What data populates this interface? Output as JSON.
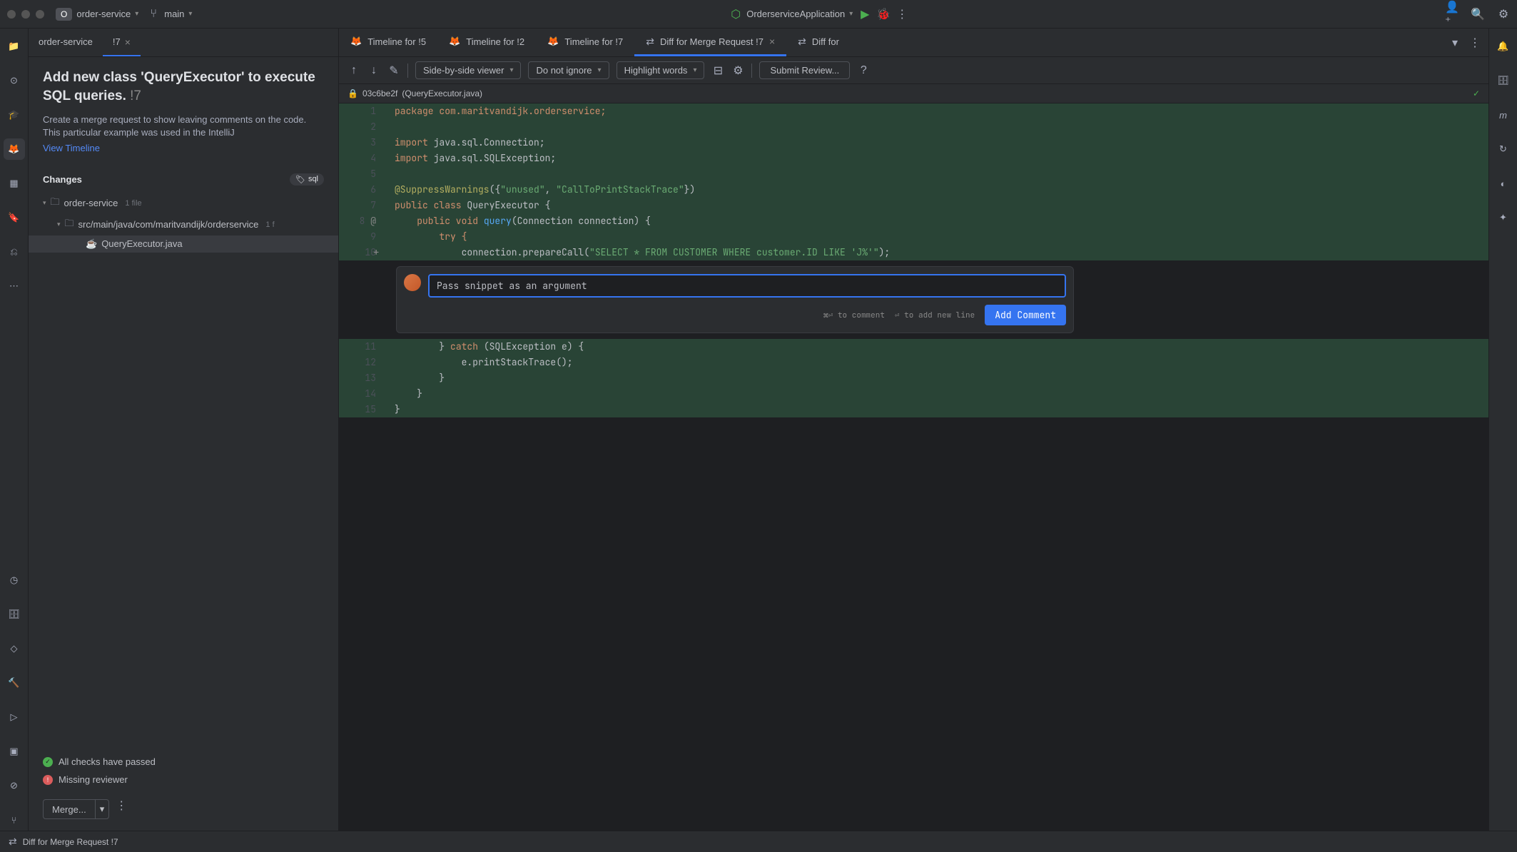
{
  "titleBar": {
    "badge": "O",
    "project": "order-service",
    "branchIcon": "⎇",
    "branch": "main",
    "runConfig": "OrderserviceApplication"
  },
  "sidebarTabs": {
    "tab0": "order-service",
    "tab1": "!7"
  },
  "mergeRequest": {
    "title": "Add new class 'QueryExecutor' to execute SQL queries.",
    "number": "!7",
    "description": "Create a merge request to show leaving comments on the code. This particular example was used in the IntelliJ",
    "viewTimeline": "View Timeline"
  },
  "changes": {
    "header": "Changes",
    "badge": "sql",
    "rootFolder": "order-service",
    "rootMeta": "1 file",
    "pathFolder": "src/main/java/com/maritvandijk/orderservice",
    "pathMeta": "1 f",
    "file": "QueryExecutor.java"
  },
  "statuses": {
    "passed": "All checks have passed",
    "reviewer": "Missing reviewer",
    "mergeBtn": "Merge..."
  },
  "editorTabs": {
    "tab0": "Timeline for !5",
    "tab1": "Timeline for !2",
    "tab2": "Timeline for !7",
    "tab3": "Diff for Merge Request !7",
    "tab4": "Diff for"
  },
  "diffToolbar": {
    "viewer": "Side-by-side viewer",
    "ignore": "Do not ignore",
    "highlight": "Highlight words",
    "submit": "Submit Review..."
  },
  "fileHeader": {
    "commit": "03c6be2f",
    "filename": "(QueryExecutor.java)"
  },
  "code": {
    "l1": "package com.maritvandijk.orderservice;",
    "l2": "",
    "l3_a": "import",
    "l3_b": " java.sql.Connection;",
    "l4_a": "import",
    "l4_b": " java.sql.SQLException;",
    "l5": "",
    "l6_a": "@SuppressWarnings",
    "l6_b": "({",
    "l6_c": "\"unused\"",
    "l6_d": ", ",
    "l6_e": "\"CallToPrintStackTrace\"",
    "l6_f": "})",
    "l7_a": "public class ",
    "l7_b": "QueryExecutor {",
    "l8_a": "    public void ",
    "l8_b": "query",
    "l8_c": "(Connection connection) {",
    "l9": "        try {",
    "l10_a": "            connection.prepareCall(",
    "l10_b": "\"SELECT * FROM CUSTOMER WHERE customer.ID LIKE 'J%'\"",
    "l10_c": ");",
    "l11_a": "        } ",
    "l11_b": "catch",
    "l11_c": " (SQLException e) {",
    "l12": "            e.printStackTrace();",
    "l13": "        }",
    "l14": "    }",
    "l15": "}"
  },
  "comment": {
    "input": "Pass snippet as an argument",
    "hint1": "⌘⏎ to comment",
    "hint2": "⏎ to add new line",
    "button": "Add Comment"
  },
  "statusBar": {
    "text": "Diff for Merge Request !7"
  }
}
